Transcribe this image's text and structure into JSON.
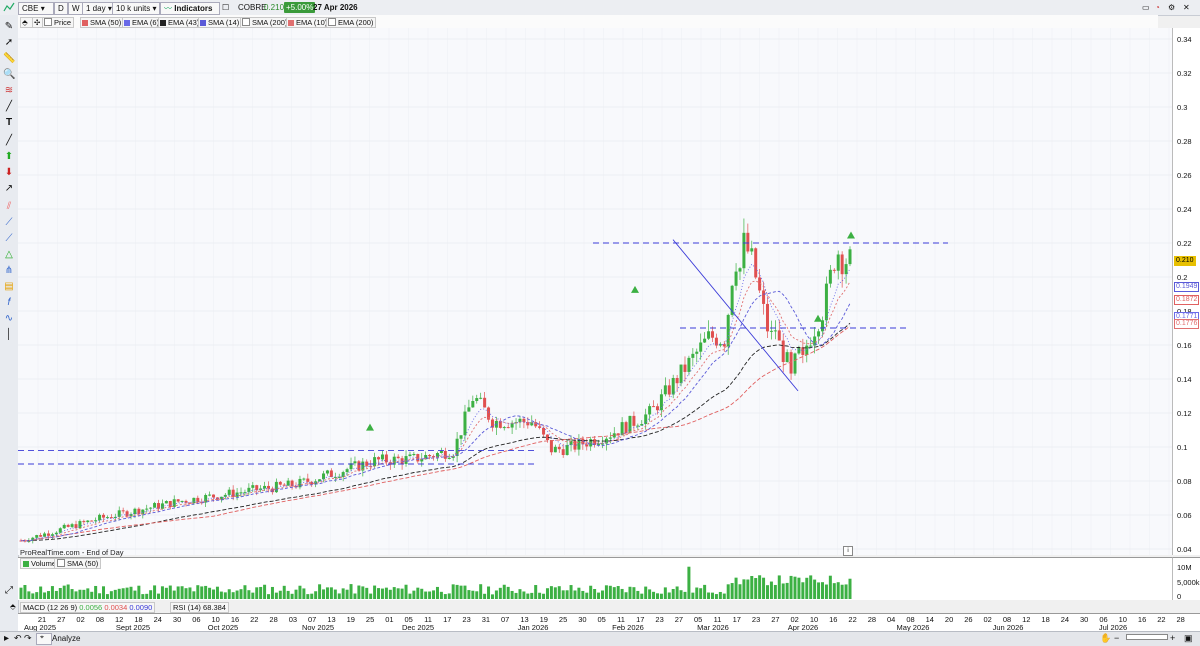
{
  "toolbar": {
    "symbol": "CBE",
    "interval": "1 day",
    "units": "10 k units",
    "indicators_label": "Indicators",
    "instrument": "COBRE",
    "last_price": "0.210",
    "change": "+5.00%",
    "date": "27 Apr 2026"
  },
  "indicator_legend": [
    {
      "label": "Price",
      "color": "#ffffff"
    },
    {
      "label": "SMA (50)",
      "color": "#e06060"
    },
    {
      "label": "EMA (6)",
      "color": "#6a6ae8"
    },
    {
      "label": "EMA (43)",
      "color": "#222222"
    },
    {
      "label": "SMA (14)",
      "color": "#5a5ad8"
    },
    {
      "label": "SMA (200)",
      "color": "#ffffff"
    },
    {
      "label": "EMA (10)",
      "color": "#e07070"
    },
    {
      "label": "EMA (200)",
      "color": "#ffffff"
    }
  ],
  "price_axis": {
    "ticks": [
      "0.34",
      "0.32",
      "0.3",
      "0.28",
      "0.26",
      "0.24",
      "0.22",
      "0.2",
      "0.18",
      "0.16",
      "0.14",
      "0.12",
      "0.1",
      "0.08",
      "0.06",
      "0.04"
    ],
    "tags": [
      {
        "text": "0.210",
        "color": "#e8c000",
        "value": 0.21
      },
      {
        "text": "0.1949",
        "color": "#5a5ad8",
        "value": 0.1949
      },
      {
        "text": "0.1872",
        "color": "#e06060",
        "value": 0.1872
      },
      {
        "text": "0.1771",
        "color": "#6a6ae8",
        "value": 0.1771
      },
      {
        "text": "0.1776",
        "color": "#e07070",
        "value": 0.1776
      }
    ]
  },
  "source_note": "ProRealTime.com - End of Day",
  "volume": {
    "legend": [
      "Volume",
      "SMA (50)"
    ],
    "ticks": [
      "10M",
      "5,000k",
      "0"
    ]
  },
  "bottom_legend": {
    "macd_label": "MACD (12 26 9)",
    "macd_v1": "0.0056",
    "macd_v2": "0.0034",
    "macd_v3": "0.0090",
    "rsi_label": "RSI (14)",
    "rsi_value": "68.384"
  },
  "x_axis": {
    "day_ticks": [
      "21",
      "27",
      "02",
      "08",
      "12",
      "18",
      "24",
      "30",
      "06",
      "10",
      "16",
      "22",
      "28",
      "03",
      "07",
      "13",
      "19",
      "25",
      "01",
      "05",
      "11",
      "17",
      "23",
      "31",
      "07",
      "13",
      "19",
      "25",
      "30",
      "05",
      "11",
      "17",
      "23",
      "27",
      "05",
      "11",
      "17",
      "23",
      "27",
      "02",
      "10",
      "16",
      "22",
      "28",
      "04",
      "08",
      "14",
      "20",
      "26",
      "02",
      "08",
      "12",
      "18",
      "24",
      "30",
      "06",
      "10",
      "16",
      "22",
      "28"
    ],
    "month_labels": [
      {
        "text": "Aug 2025"
      },
      {
        "text": "Sept 2025"
      },
      {
        "text": "Oct 2025"
      },
      {
        "text": "Nov 2025"
      },
      {
        "text": "Dec 2025"
      },
      {
        "text": "Jan 2026"
      },
      {
        "text": "Feb 2026"
      },
      {
        "text": "Mar 2026"
      },
      {
        "text": "Apr 2026"
      },
      {
        "text": "May 2026"
      },
      {
        "text": "Jun 2026"
      },
      {
        "text": "Jul 2026"
      }
    ]
  },
  "status_bar": {
    "analyze": "Analyze"
  },
  "colors": {
    "up": "#3cb043",
    "down": "#e05050",
    "hline": "#3a3ad8"
  }
}
